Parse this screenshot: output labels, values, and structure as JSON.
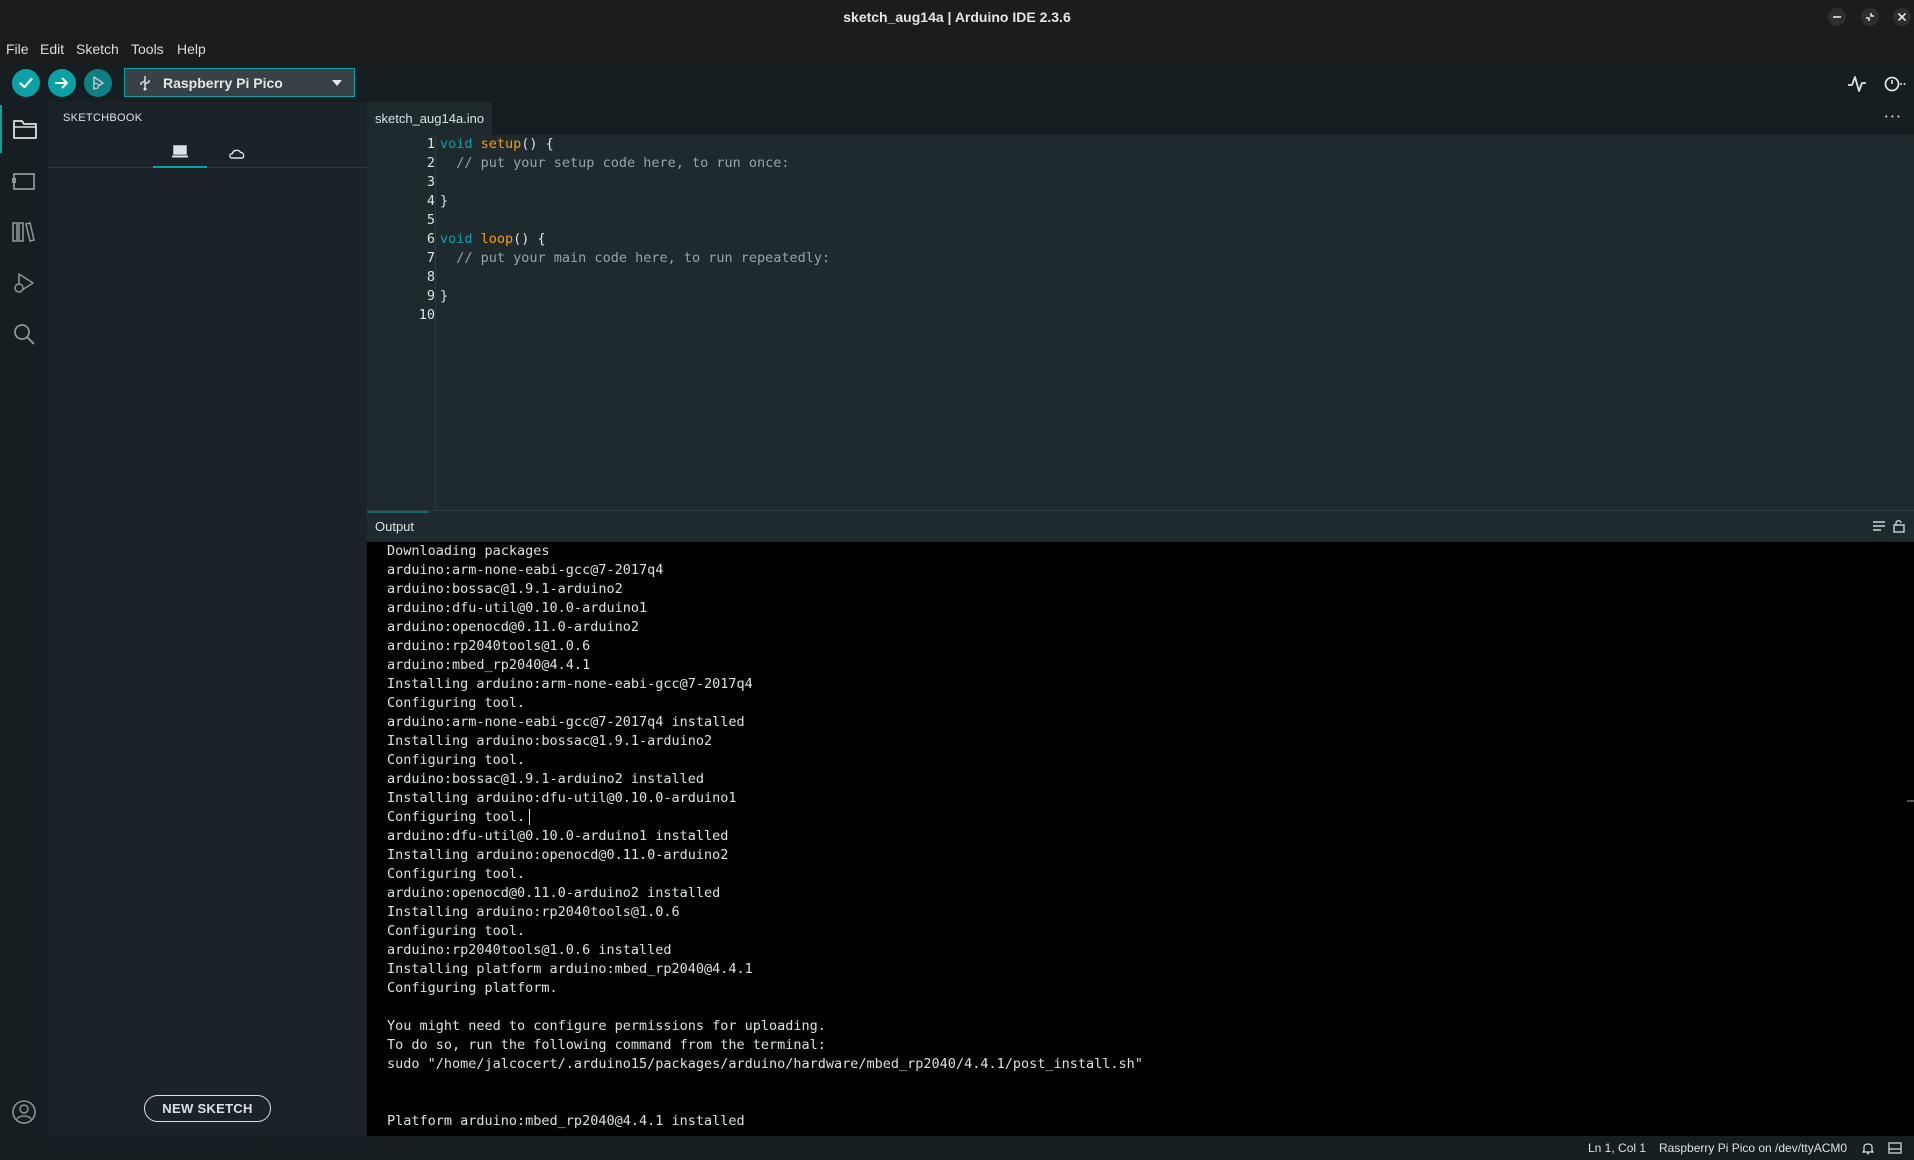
{
  "window": {
    "title": "sketch_aug14a | Arduino IDE 2.3.6",
    "controls": [
      "minimize",
      "maximize",
      "close"
    ]
  },
  "menu": {
    "items": [
      "File",
      "Edit",
      "Sketch",
      "Tools",
      "Help"
    ]
  },
  "toolbar": {
    "verify_icon": "check-icon",
    "upload_icon": "arrow-right-icon",
    "debug_icon": "debug-icon",
    "board_name": "Raspberry Pi Pico",
    "serial_plotter_icon": "plotter-icon",
    "serial_monitor_icon": "serial-monitor-icon"
  },
  "sidebar": {
    "header": "SKETCHBOOK",
    "new_sketch_label": "NEW SKETCH"
  },
  "editor": {
    "tab": "sketch_aug14a.ino",
    "more": "···",
    "line_numbers": [
      "1",
      "2",
      "3",
      "4",
      "5",
      "6",
      "7",
      "8",
      "9",
      "10"
    ],
    "code": {
      "l1_kw": "void",
      "l1_fn": "setup",
      "l1_rest": "() {",
      "l2_comment": "// put your setup code here, to run once:",
      "l4": "}",
      "l6_kw": "void",
      "l6_fn": "loop",
      "l6_rest": "() {",
      "l7_comment": "// put your main code here, to run repeatedly:",
      "l9": "}"
    }
  },
  "output": {
    "title": "Output",
    "lines": [
      "Downloading packages",
      "arduino:arm-none-eabi-gcc@7-2017q4",
      "arduino:bossac@1.9.1-arduino2",
      "arduino:dfu-util@0.10.0-arduino1",
      "arduino:openocd@0.11.0-arduino2",
      "arduino:rp2040tools@1.0.6",
      "arduino:mbed_rp2040@4.4.1",
      "Installing arduino:arm-none-eabi-gcc@7-2017q4",
      "Configuring tool.",
      "arduino:arm-none-eabi-gcc@7-2017q4 installed",
      "Installing arduino:bossac@1.9.1-arduino2",
      "Configuring tool.",
      "arduino:bossac@1.9.1-arduino2 installed",
      "Installing arduino:dfu-util@0.10.0-arduino1",
      "Configuring tool.",
      "arduino:dfu-util@0.10.0-arduino1 installed",
      "Installing arduino:openocd@0.11.0-arduino2",
      "Configuring tool.",
      "arduino:openocd@0.11.0-arduino2 installed",
      "Installing arduino:rp2040tools@1.0.6",
      "Configuring tool.",
      "arduino:rp2040tools@1.0.6 installed",
      "Installing platform arduino:mbed_rp2040@4.4.1",
      "Configuring platform.",
      "",
      "You might need to configure permissions for uploading.",
      "To do so, run the following command from the terminal:",
      "sudo \"/home/jalcocert/.arduino15/packages/arduino/hardware/mbed_rp2040/4.4.1/post_install.sh\"",
      "",
      "",
      "Platform arduino:mbed_rp2040@4.4.1 installed"
    ]
  },
  "status": {
    "cursor_position": "Ln 1, Col 1",
    "board_port": "Raspberry Pi Pico on /dev/ttyACM0"
  },
  "colors": {
    "accent": "#0ca1a6",
    "background": "#171e21",
    "editor_bg": "#1f2a2f",
    "output_bg": "#000000",
    "function": "#f39c12",
    "comment": "#95a5a6"
  }
}
